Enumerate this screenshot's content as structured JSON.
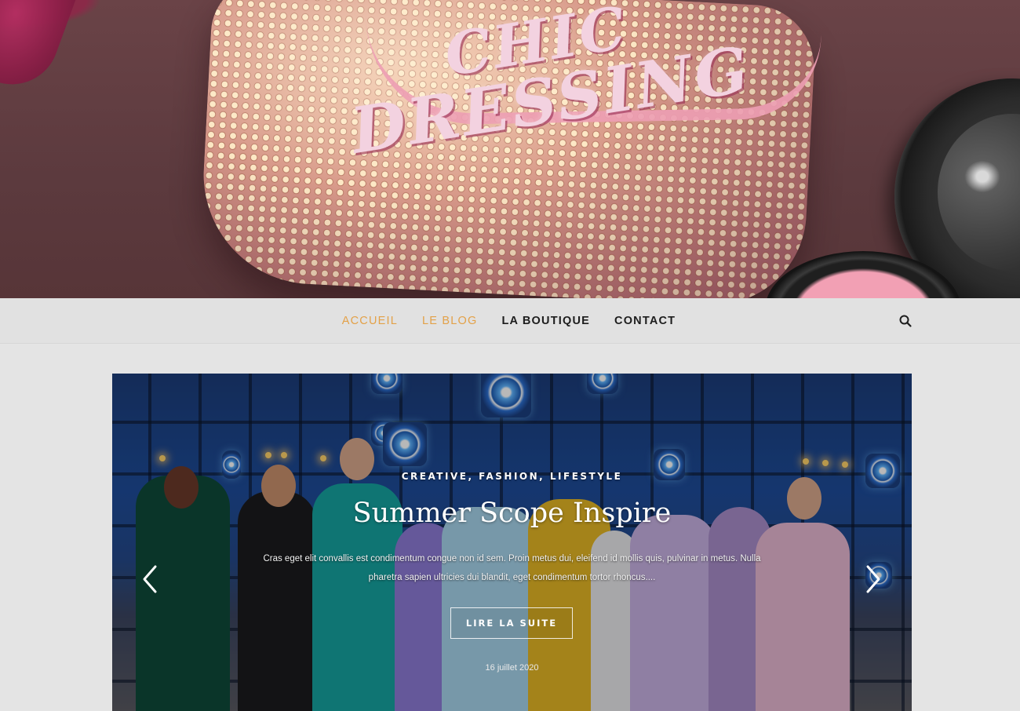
{
  "header": {
    "title_line1": "CHIC",
    "title_line2": "DRESSING"
  },
  "nav": {
    "items": [
      {
        "label": "ACCUEIL",
        "active": true
      },
      {
        "label": "LE BLOG",
        "active": true
      },
      {
        "label": "LA BOUTIQUE",
        "active": false
      },
      {
        "label": "CONTACT",
        "active": false
      }
    ],
    "search_icon": "search-icon",
    "active_color": "#e3a148"
  },
  "slider": {
    "categories": "CREATIVE, FASHION, LIFESTYLE",
    "title": "Summer Scope Inspire",
    "excerpt": "Cras eget elit convallis est condimentum congue non id sem. Proin metus dui, eleifend id mollis quis, pulvinar in metus. Nulla pharetra sapien ultricies dui blandit, eget condimentum tortor rhoncus....",
    "read_more": "LIRE LA SUITE",
    "date": "16 juillet 2020",
    "prev_icon": "chevron-left-icon",
    "next_icon": "chevron-right-icon"
  }
}
